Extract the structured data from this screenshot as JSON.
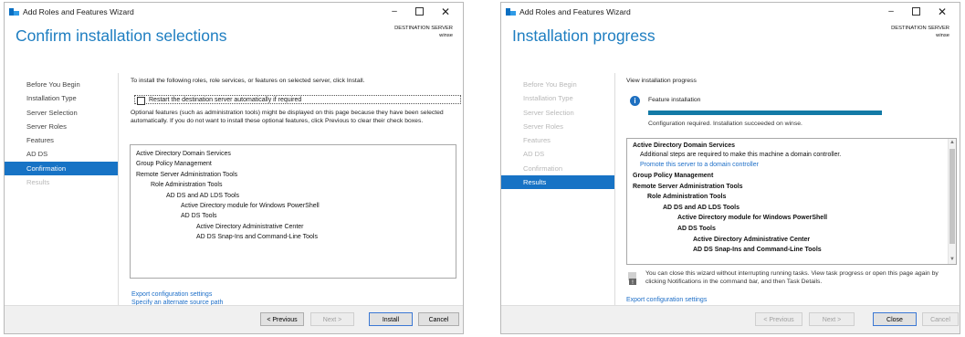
{
  "window1": {
    "title": "Add Roles and Features Wizard",
    "controls": {
      "minimize": "–",
      "maximize": "",
      "close": "✕"
    },
    "page_title": "Confirm installation selections",
    "destination": {
      "label": "DESTINATION SERVER",
      "server": "winse"
    },
    "nav": [
      "Before You Begin",
      "Installation Type",
      "Server Selection",
      "Server Roles",
      "Features",
      "AD DS",
      "Confirmation",
      "Results"
    ],
    "intro": "To install the following roles, role services, or features on selected server, click Install.",
    "restart_checkbox_label": "Restart the destination server automatically if required",
    "optional_text": "Optional features (such as administration tools) might be displayed on this page because they have been selected automatically. If you do not want to install these optional features, click Previous to clear their check boxes.",
    "features": [
      "Active Directory Domain Services",
      "Group Policy Management",
      "Remote Server Administration Tools",
      "Role Administration Tools",
      "AD DS and AD LDS Tools",
      "Active Directory module for Windows PowerShell",
      "AD DS Tools",
      "Active Directory Administrative Center",
      "AD DS Snap-Ins and Command-Line Tools"
    ],
    "links": {
      "export": "Export configuration settings",
      "alternate": "Specify an alternate source path"
    },
    "buttons": {
      "previous": "< Previous",
      "next": "Next >",
      "install": "Install",
      "cancel": "Cancel"
    }
  },
  "window2": {
    "title": "Add Roles and Features Wizard",
    "controls": {
      "minimize": "–",
      "maximize": "",
      "close": "✕"
    },
    "page_title": "Installation progress",
    "destination": {
      "label": "DESTINATION SERVER",
      "server": "winse"
    },
    "nav": [
      "Before You Begin",
      "Installation Type",
      "Server Selection",
      "Server Roles",
      "Features",
      "AD DS",
      "Confirmation",
      "Results"
    ],
    "view_label": "View installation progress",
    "feature_installation": "Feature installation",
    "progress": 1.0,
    "status": "Configuration required. Installation succeeded on winse.",
    "results": {
      "adds_title": "Active Directory Domain Services",
      "adds_note": "Additional steps are required to make this machine a domain controller.",
      "promote_link": "Promote this server to a domain controller",
      "items": [
        "Group Policy Management",
        "Remote Server Administration Tools",
        "Role Administration Tools",
        "AD DS and AD LDS Tools",
        "Active Directory module for Windows PowerShell",
        "AD DS Tools",
        "Active Directory Administrative Center",
        "AD DS Snap-Ins and Command-Line Tools"
      ]
    },
    "close_note": "You can close this wizard without interrupting running tasks. View task progress or open this page again by clicking Notifications in the command bar, and then Task Details.",
    "export_link": "Export configuration settings",
    "buttons": {
      "previous": "< Previous",
      "next": "Next >",
      "close": "Close",
      "cancel": "Cancel"
    }
  },
  "colors": {
    "accent": "#1773c5",
    "title_blue": "#1e7ec1",
    "progress": "#137aa6",
    "link": "#1e6fc8"
  },
  "icons": {
    "app": "server-manager-icon",
    "info": "info-icon",
    "notification": "flag-icon"
  }
}
